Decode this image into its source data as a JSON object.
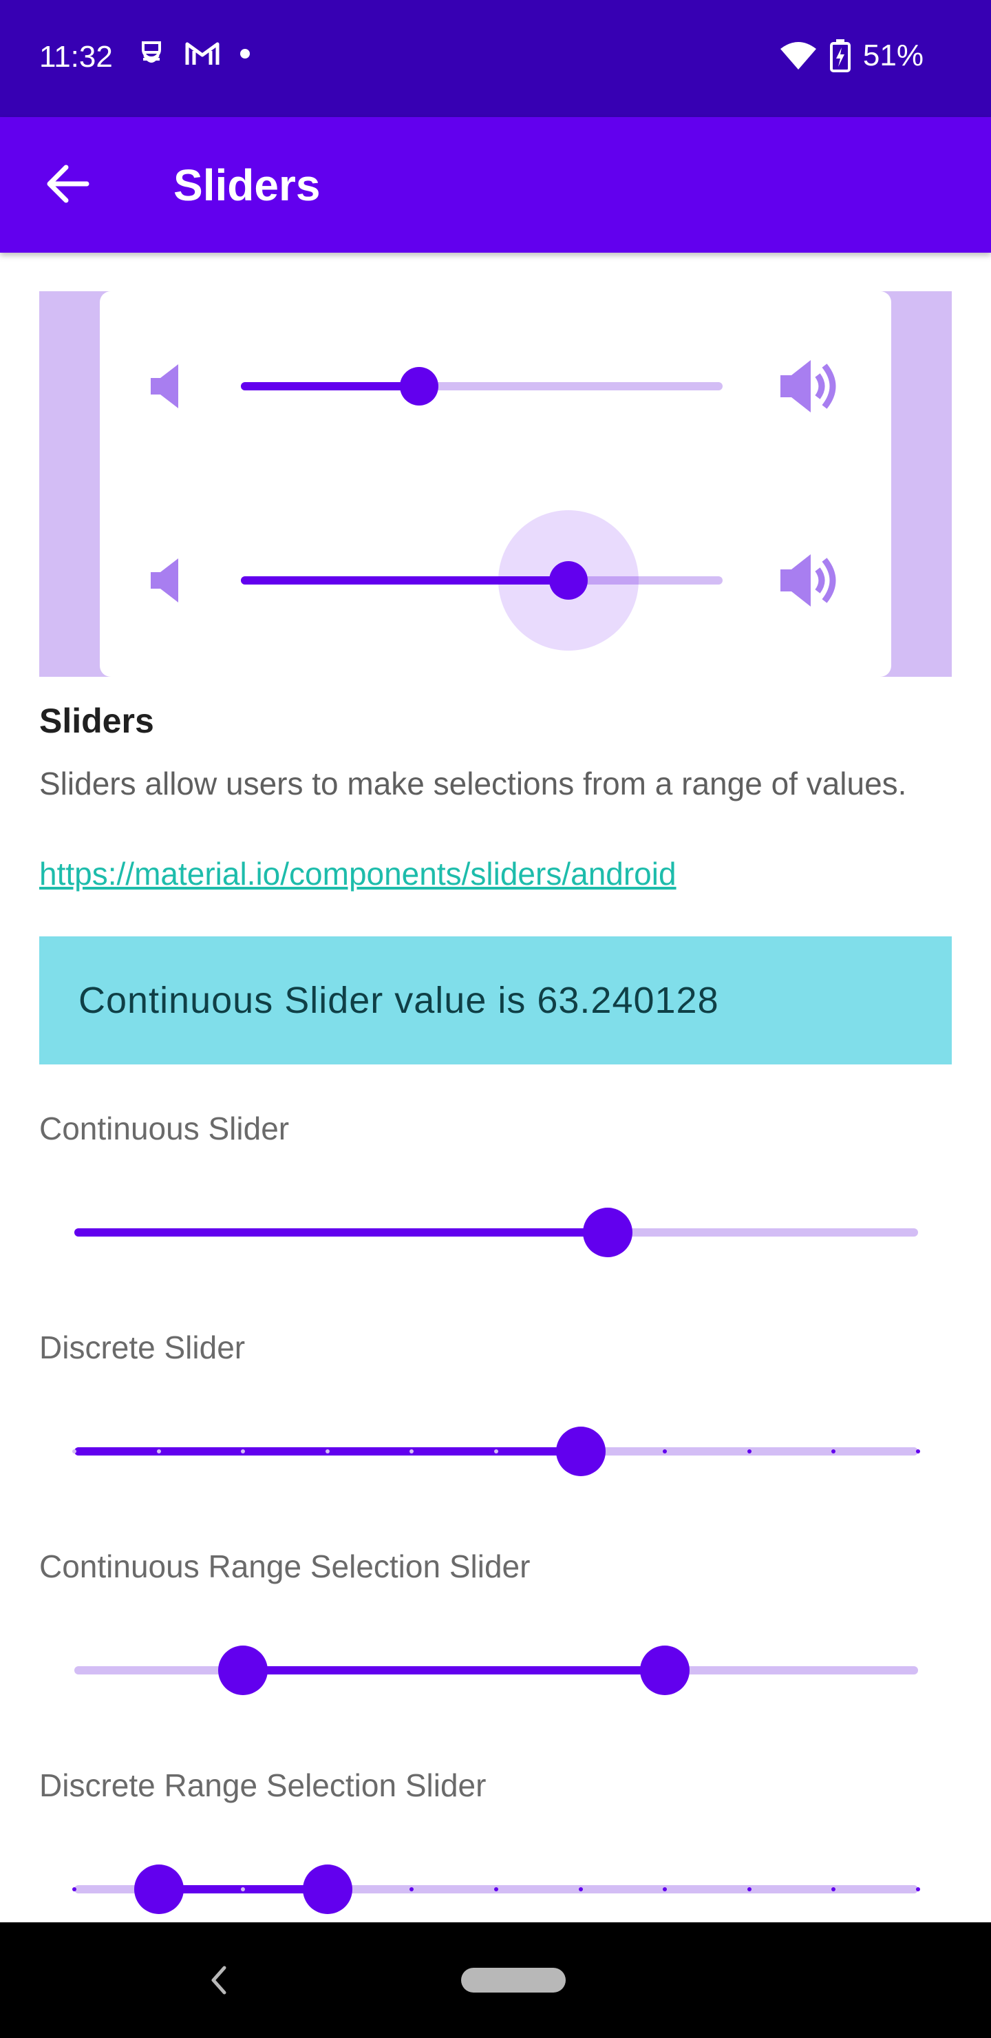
{
  "status_bar": {
    "time": "11:32",
    "battery": "51%",
    "icons": [
      "pocket-icon",
      "gmail-icon",
      "dot-icon",
      "wifi-icon",
      "battery-charging-icon"
    ]
  },
  "app_bar": {
    "title": "Sliders",
    "back_icon": "arrow-left-icon"
  },
  "hero": {
    "sliders": [
      {
        "value": 0.37,
        "focused": false
      },
      {
        "value": 0.68,
        "focused": true
      }
    ],
    "icons": [
      "volume-low-icon",
      "volume-high-icon"
    ]
  },
  "section": {
    "title": "Sliders",
    "description": "Sliders allow users to make selections from a range of values.",
    "link": "https://material.io/components/sliders/android"
  },
  "value_box": {
    "text": "Continuous Slider value is 63.240128"
  },
  "sliders": {
    "continuous": {
      "label": "Continuous Slider",
      "value": 0.632
    },
    "discrete": {
      "label": "Discrete Slider",
      "value": 0.6,
      "steps": 10
    },
    "continuous_range": {
      "label": "Continuous Range Selection Slider",
      "values": [
        0.2,
        0.7
      ]
    },
    "discrete_range": {
      "label": "Discrete Range Selection Slider",
      "values": [
        0.1,
        0.3
      ],
      "steps": 10
    }
  },
  "colors": {
    "primary": "#6200ee",
    "primary_dark": "#3700b3",
    "track_inactive": "#d3bdf5",
    "value_box": "#80deea",
    "link": "#1dbcab"
  }
}
